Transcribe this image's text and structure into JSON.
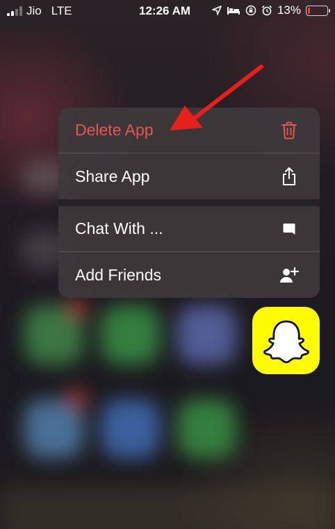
{
  "status_bar": {
    "carrier": "Jio",
    "network": "LTE",
    "time": "12:26 AM",
    "battery": "13%",
    "battery_color": "#ff3b30"
  },
  "context_menu": {
    "items": [
      {
        "label": "Delete App",
        "icon": "trash-icon",
        "color": "#e6574d"
      },
      {
        "label": "Share App",
        "icon": "share-icon"
      },
      {
        "label": "Chat With ...",
        "icon": "chat-bubble-icon"
      },
      {
        "label": "Add Friends",
        "icon": "add-friend-icon"
      }
    ]
  },
  "app": {
    "icon": "snapchat-ghost-icon",
    "brand_color": "#fffc00"
  },
  "annotation": {
    "arrow_color": "#e8201c",
    "points_to": "Delete App"
  }
}
